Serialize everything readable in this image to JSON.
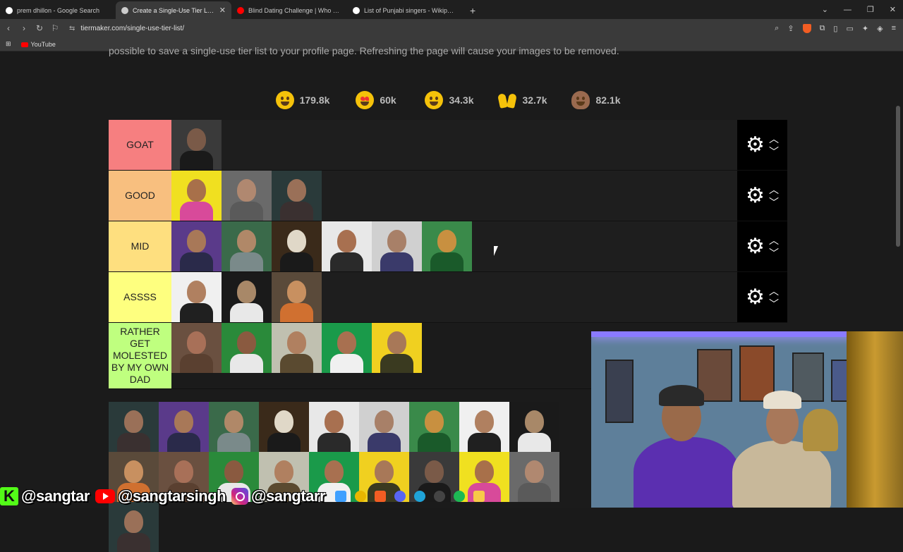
{
  "browser": {
    "tabs": [
      {
        "title": "prem dhillon - Google Search",
        "active": false,
        "favicon_color": "#ffffff"
      },
      {
        "title": "Create a Single-Use Tier List (Pri",
        "active": true,
        "favicon_color": "#cccccc"
      },
      {
        "title": "Blind Dating Challenge | Who Will Ki",
        "active": false,
        "favicon_color": "#ff0000"
      },
      {
        "title": "List of Punjabi singers - Wikipedia",
        "active": false,
        "favicon_color": "#ffffff"
      }
    ],
    "new_tab": "+",
    "url": "tiermaker.com/single-use-tier-list/",
    "bookmark": "YouTube"
  },
  "page": {
    "intro_text": "possible to save a single-use tier list to your profile page. Refreshing the page will cause your images to be removed.",
    "reactions": [
      {
        "icon": "grin-emoji",
        "count": "179.8k",
        "style": ""
      },
      {
        "icon": "heart-eyes-emoji",
        "count": "60k",
        "style": "heart"
      },
      {
        "icon": "laughing-emoji",
        "count": "34.3k",
        "style": ""
      },
      {
        "icon": "raised-hands-emoji",
        "count": "32.7k",
        "style": "hands"
      },
      {
        "icon": "poop-emoji",
        "count": "82.1k",
        "style": "poop"
      }
    ],
    "tiers": [
      {
        "label": "GOAT",
        "color": "#f67f80",
        "items": 1
      },
      {
        "label": "GOOD",
        "color": "#f8bf7f",
        "items": 3
      },
      {
        "label": "MID",
        "color": "#fedf7f",
        "items": 6
      },
      {
        "label": "ASSSS",
        "color": "#feff7f",
        "items": 3
      },
      {
        "label": "RATHER GET MOLESTED BY MY OWN DAD",
        "color": "#bfff7f",
        "items": 5
      }
    ],
    "unranked_count": 19
  },
  "overlay": {
    "kick_letter": "K",
    "kick_handle": "@sangtar",
    "youtube_handle": "@sangtarsingh",
    "instagram_handle": "@sangtarr"
  }
}
